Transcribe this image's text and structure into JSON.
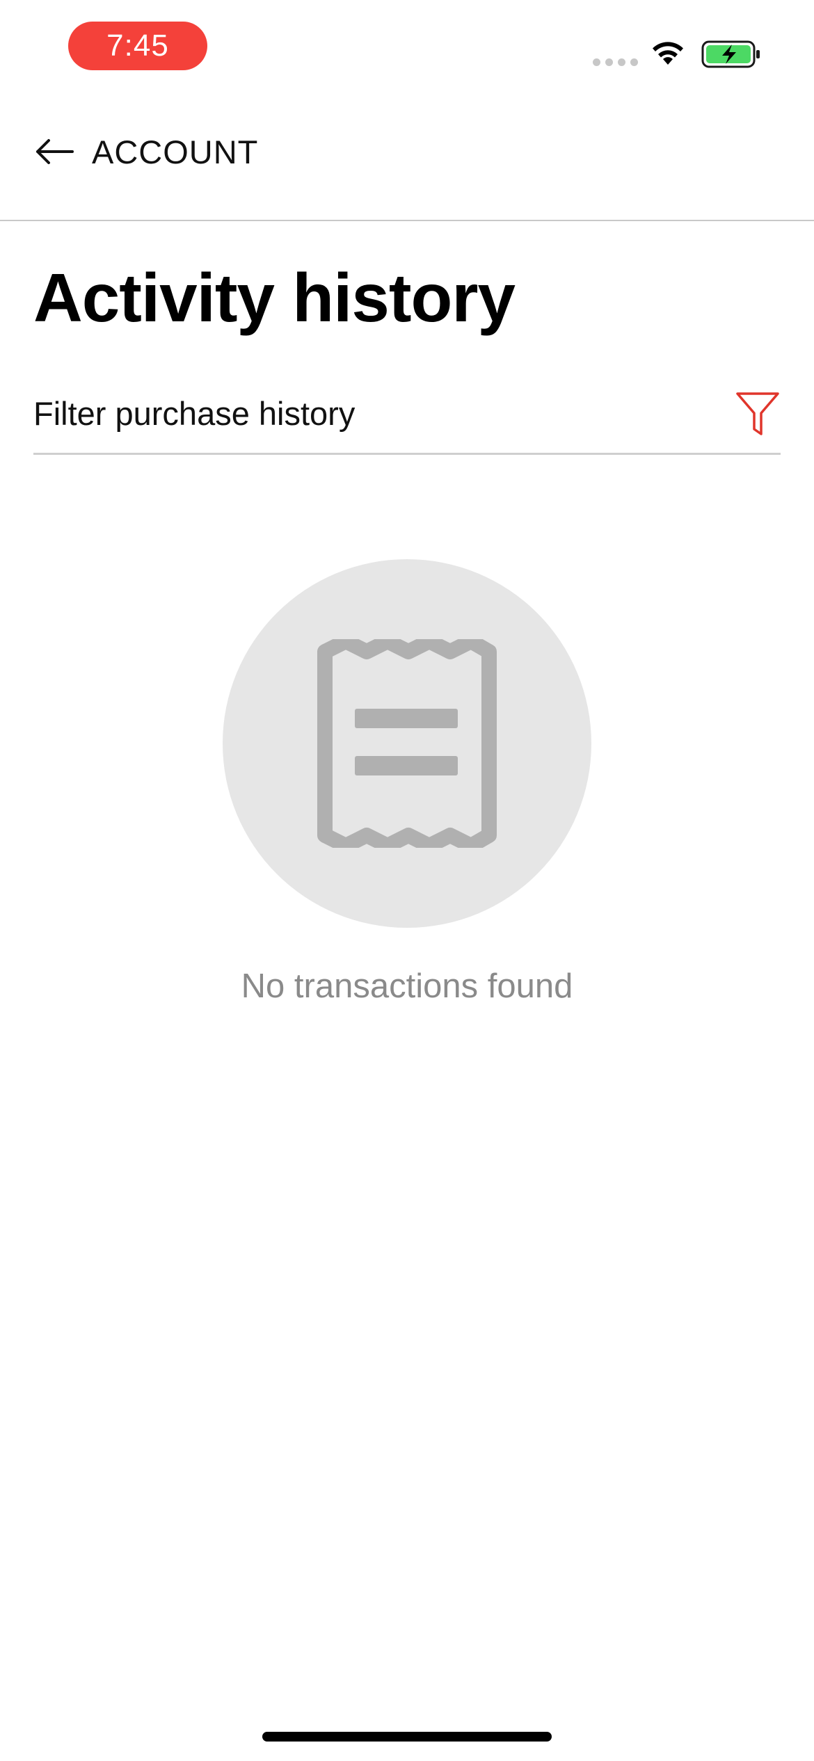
{
  "status_bar": {
    "time": "7:45",
    "time_pill_color": "#f4413a",
    "battery_color": "#4cd964",
    "icons": [
      "signal-dots-icon",
      "wifi-icon",
      "battery-charging-icon"
    ]
  },
  "nav": {
    "back_label": "ACCOUNT",
    "back_icon": "arrow-left-icon"
  },
  "page": {
    "title": "Activity history"
  },
  "filter": {
    "label": "Filter purchase history",
    "icon": "filter-funnel-icon",
    "icon_color": "#e0352b"
  },
  "empty_state": {
    "icon": "receipt-icon",
    "message": "No transactions found"
  }
}
